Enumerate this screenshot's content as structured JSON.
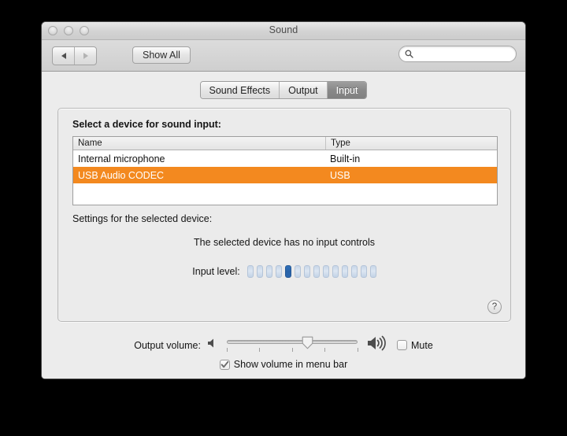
{
  "window": {
    "title": "Sound",
    "traffic_lights": [
      "close",
      "minimize",
      "zoom"
    ]
  },
  "toolbar": {
    "back_label": "◀",
    "forward_label": "▶",
    "show_all_label": "Show All",
    "search_value": "",
    "search_placeholder": ""
  },
  "tabs": [
    {
      "label": "Sound Effects",
      "selected": false
    },
    {
      "label": "Output",
      "selected": false
    },
    {
      "label": "Input",
      "selected": true
    }
  ],
  "panel": {
    "heading": "Select a device for sound input:",
    "table": {
      "columns": [
        "Name",
        "Type"
      ],
      "rows": [
        {
          "name": "Internal microphone",
          "type": "Built-in",
          "selected": false
        },
        {
          "name": "USB Audio CODEC",
          "type": "USB",
          "selected": true
        }
      ]
    },
    "settings_heading": "Settings for the selected device:",
    "no_controls_message": "The selected device has no input controls",
    "input_level": {
      "label": "Input level:",
      "segments": 14,
      "active_index": 5
    },
    "help_label": "?"
  },
  "bottom": {
    "output_volume_label": "Output volume:",
    "slider_value_percent": 62,
    "slider_tick_count": 5,
    "mute_label": "Mute",
    "mute_checked": false,
    "menu_bar_label": "Show volume in menu bar",
    "menu_bar_checked": true
  },
  "colors": {
    "selection_orange": "#f3891f",
    "level_active_blue": "#2f6fb8",
    "window_background": "#ececec",
    "page_background": "#000000"
  }
}
